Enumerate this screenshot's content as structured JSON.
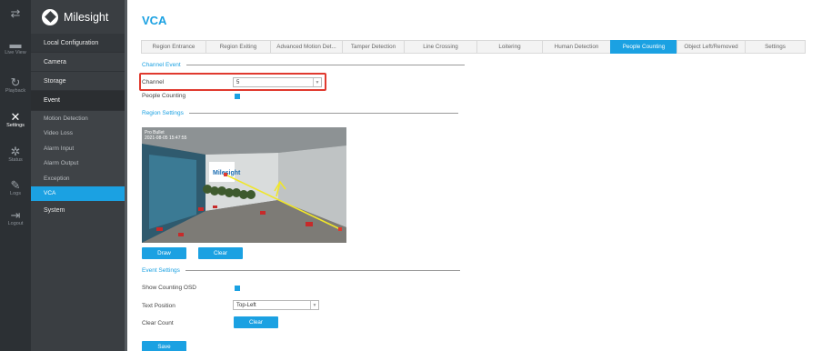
{
  "rail": {
    "top_icon": "⇄",
    "items": [
      {
        "icon": "▬",
        "label": "Live View"
      },
      {
        "icon": "↻",
        "label": "Playback"
      },
      {
        "icon": "✕",
        "label": "Settings"
      },
      {
        "icon": "✲",
        "label": "Status"
      },
      {
        "icon": "✎",
        "label": "Logs"
      },
      {
        "icon": "⇥",
        "label": "Logout"
      }
    ]
  },
  "menu": {
    "brand": "Milesight",
    "items": [
      "Local Configuration",
      "Camera",
      "Storage",
      "Event"
    ],
    "sub_items": [
      "Motion Detection",
      "Video Loss",
      "Alarm Input",
      "Alarm Output",
      "Exception",
      "VCA"
    ],
    "system": "System"
  },
  "page": {
    "title": "VCA",
    "tabs": [
      "Region Entrance",
      "Region Exiting",
      "Advanced Motion Det...",
      "Tamper Detection",
      "Line Crossing",
      "Loitering",
      "Human Detection",
      "People Counting",
      "Object Left/Removed",
      "Settings"
    ],
    "active_tab": "People Counting",
    "channel_event_legend": "Channel Event",
    "channel_label": "Channel",
    "channel_value": "5",
    "people_counting_label": "People Counting",
    "region_settings_legend": "Region Settings",
    "osd_line1": "Pro Bullet",
    "osd_line2": "2021-08-05 15:47:55",
    "draw_label": "Draw",
    "clear_label": "Clear",
    "event_settings_legend": "Event Settings",
    "show_osd_label": "Show Counting OSD",
    "text_position_label": "Text Position",
    "text_position_value": "Top-Left",
    "clear_count_label": "Clear Count",
    "clear_count_button": "Clear",
    "save_label": "Save"
  },
  "colors": {
    "accent": "#1ba1e2",
    "highlight": "#e03a2f",
    "dark_bg": "#2c3034",
    "menu_bg": "#3a3e42"
  }
}
